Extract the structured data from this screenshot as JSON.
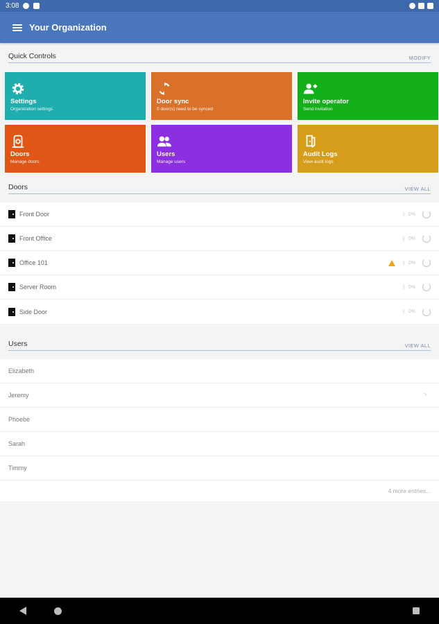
{
  "status_bar": {
    "time": "3:08"
  },
  "app_bar": {
    "title": "Your Organization"
  },
  "quick_controls": {
    "label": "Quick Controls",
    "action": "MODIFY",
    "tiles": [
      {
        "title": "Settings",
        "subtitle": "Organization settings",
        "color": "#1fadad",
        "icon": "gear-icon"
      },
      {
        "title": "Door sync",
        "subtitle": "0 door(s) need to be synced",
        "color": "#d9712a",
        "icon": "sync-icon"
      },
      {
        "title": "Invite operator",
        "subtitle": "Send invitation",
        "color": "#14b01a",
        "icon": "add-user-icon"
      },
      {
        "title": "Doors",
        "subtitle": "Manage doors",
        "color": "#df5616",
        "icon": "door-icon"
      },
      {
        "title": "Users",
        "subtitle": "Manage users",
        "color": "#8b2fe0",
        "icon": "users-icon"
      },
      {
        "title": "Audit Logs",
        "subtitle": "View audit logs",
        "color": "#d59d1a",
        "icon": "logs-icon"
      }
    ]
  },
  "doors": {
    "label": "Doors",
    "action": "VIEW ALL",
    "items": [
      {
        "name": "Front Door",
        "battery": "0%",
        "warning": false
      },
      {
        "name": "Front Office",
        "battery": "0%",
        "warning": false
      },
      {
        "name": "Office 101",
        "battery": "0%",
        "warning": true
      },
      {
        "name": "Server Room",
        "battery": "0%",
        "warning": false
      },
      {
        "name": "Side Door",
        "battery": "0%",
        "warning": false
      }
    ]
  },
  "users": {
    "label": "Users",
    "action": "VIEW ALL",
    "items": [
      {
        "name": "Elizabeth",
        "rss": false
      },
      {
        "name": "Jeremy",
        "rss": true
      },
      {
        "name": "Phoebe",
        "rss": false
      },
      {
        "name": "Sarah",
        "rss": false
      },
      {
        "name": "Timmy",
        "rss": false
      }
    ],
    "more": "4 more entries..."
  },
  "colors": {
    "primary": "#4a76bb",
    "status_bar": "#3f69ad",
    "warning": "#f2a516"
  }
}
